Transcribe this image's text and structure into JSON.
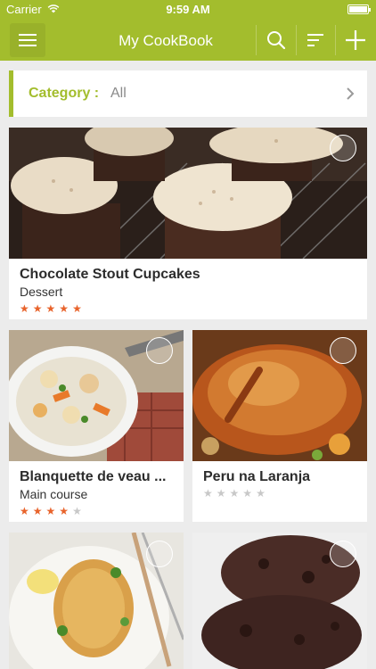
{
  "status_bar": {
    "carrier": "Carrier",
    "time": "9:59 AM"
  },
  "nav": {
    "title": "My CookBook",
    "icons": [
      "menu-icon",
      "search-icon",
      "sort-icon",
      "plus-icon"
    ]
  },
  "category": {
    "label": "Category :",
    "value": "All"
  },
  "recipes": [
    {
      "name": "Chocolate Stout Cupcakes",
      "category": "Dessert",
      "rating": 5,
      "max_rating": 5
    },
    {
      "name": "Blanquette de veau ...",
      "category": "Main course",
      "rating": 4,
      "max_rating": 5
    },
    {
      "name": "Peru na Laranja",
      "category": "",
      "rating": 0,
      "max_rating": 5
    },
    {
      "name": "",
      "category": "",
      "rating": 0,
      "max_rating": 5
    },
    {
      "name": "",
      "category": "",
      "rating": 0,
      "max_rating": 5
    }
  ],
  "colors": {
    "accent": "#a3bd2d",
    "star_on": "#e8632b",
    "star_off": "#c8c8c8",
    "background": "#ececec"
  }
}
